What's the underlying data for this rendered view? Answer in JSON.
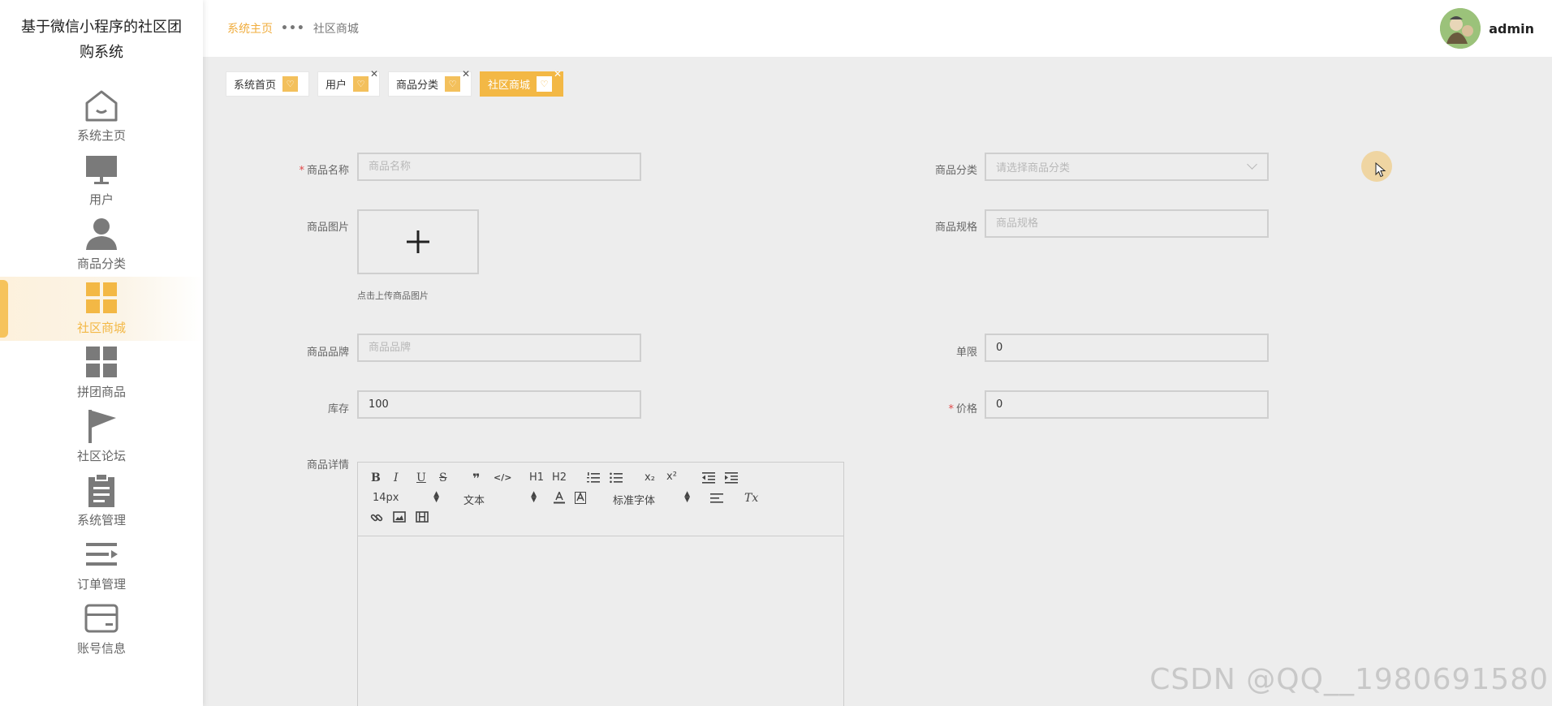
{
  "app": {
    "title_line1": "基于微信小程序的社区团",
    "title_line2": "购系统"
  },
  "sidebar": {
    "items": [
      {
        "label": "系统主页",
        "icon": "home-icon"
      },
      {
        "label": "用户",
        "icon": "monitor-icon"
      },
      {
        "label": "商品分类",
        "icon": "user-icon"
      },
      {
        "label": "社区商城",
        "icon": "grid-icon",
        "active": true
      },
      {
        "label": "拼团商品",
        "icon": "grid-icon"
      },
      {
        "label": "社区论坛",
        "icon": "flag-icon"
      },
      {
        "label": "系统管理",
        "icon": "clipboard-icon"
      },
      {
        "label": "订单管理",
        "icon": "list-icon"
      },
      {
        "label": "账号信息",
        "icon": "card-icon"
      }
    ]
  },
  "header": {
    "breadcrumb_home": "系统主页",
    "breadcrumb_sep": "•••",
    "breadcrumb_current": "社区商城",
    "username": "admin"
  },
  "tags": [
    {
      "label": "系统首页",
      "closable": false
    },
    {
      "label": "用户",
      "closable": true
    },
    {
      "label": "商品分类",
      "closable": true
    },
    {
      "label": "社区商城",
      "closable": true,
      "active": true
    }
  ],
  "form": {
    "name": {
      "label": "商品名称",
      "required": "*",
      "placeholder": "商品名称",
      "value": ""
    },
    "category": {
      "label": "商品分类",
      "placeholder": "请选择商品分类"
    },
    "image": {
      "label": "商品图片",
      "hint": "点击上传商品图片"
    },
    "spec": {
      "label": "商品规格",
      "placeholder": "商品规格",
      "value": ""
    },
    "brand": {
      "label": "商品品牌",
      "placeholder": "商品品牌",
      "value": ""
    },
    "limit": {
      "label": "单限",
      "value": "0"
    },
    "stock": {
      "label": "库存",
      "value": "100"
    },
    "price": {
      "label": "价格",
      "required": "*",
      "value": "0"
    },
    "detail": {
      "label": "商品详情"
    }
  },
  "editor": {
    "font_size": "14px",
    "header_select": "文本",
    "font_family": "标准字体",
    "buttons": {
      "bold": "B",
      "italic": "I",
      "underline": "U",
      "strike": "S",
      "quote": "❞",
      "code": "</>",
      "h1": "H1",
      "h2": "H2",
      "sub": "x₂",
      "sup": "x²",
      "clean": "Tx"
    }
  },
  "accent_color": "#f3b845",
  "watermark": "CSDN @QQ__1980691580"
}
